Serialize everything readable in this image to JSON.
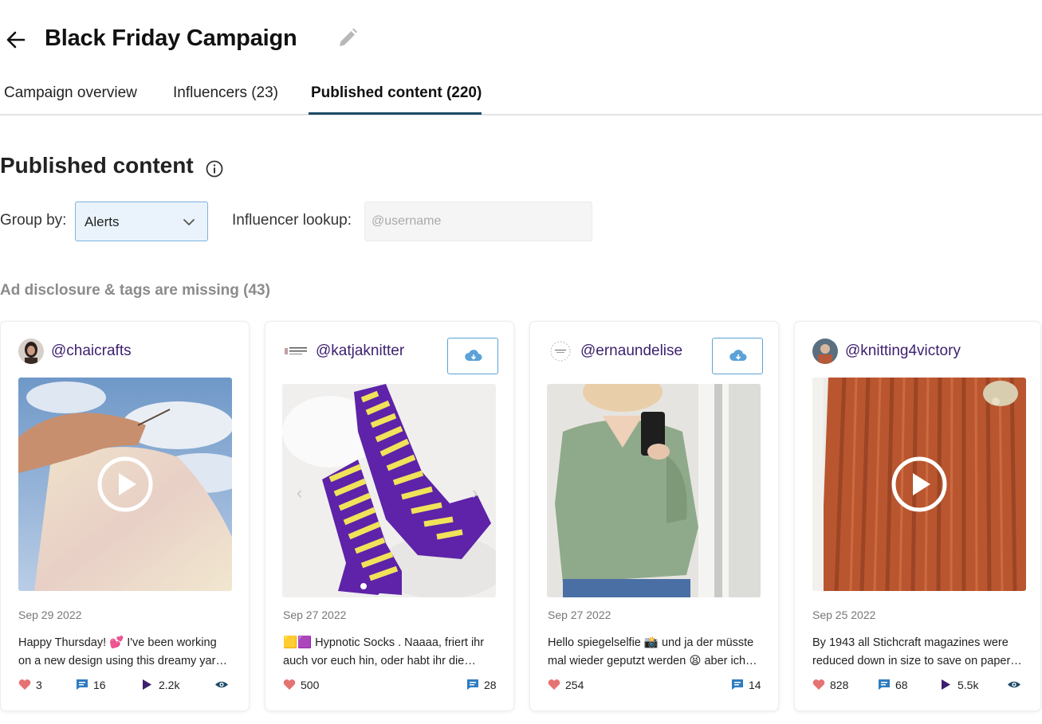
{
  "header": {
    "title": "Black Friday Campaign"
  },
  "tabs": [
    {
      "label": "Campaign overview"
    },
    {
      "label": "Influencers (23)"
    },
    {
      "label": "Published content (220)"
    }
  ],
  "section": {
    "title": "Published content"
  },
  "filters": {
    "group_by_label": "Group by:",
    "group_by_value": "Alerts",
    "lookup_label": "Influencer lookup:",
    "lookup_placeholder": "@username"
  },
  "group": {
    "heading": "Ad disclosure & tags are missing (43)"
  },
  "colors": {
    "accent": "#1d4a66",
    "username": "#3c1f6e",
    "download": "#5aa2d8",
    "like": "#e57373",
    "comment": "#2f7cc0",
    "play": "#3c1f6e"
  },
  "cards": [
    {
      "username": "@chaicrafts",
      "date": "Sep 29 2022",
      "caption_line1": "Happy Thursday! 💕 I've been working",
      "caption_line2": "on a new design using this dreamy yar…",
      "likes": "3",
      "comments": "16",
      "plays": "2.2k",
      "has_download": false,
      "is_video": true
    },
    {
      "username": "@katjaknitter",
      "date": "Sep 27 2022",
      "caption_line1": "🟨🟪 Hypnotic Socks . Naaaa, friert ihr",
      "caption_line2": "auch vor euch hin, oder habt ihr die…",
      "likes": "500",
      "comments": "28",
      "has_download": true,
      "is_video": false
    },
    {
      "username": "@ernaundelise",
      "date": "Sep 27 2022",
      "caption_line1": "Hello spiegelselfie 📸 und ja der müsste",
      "caption_line2": "mal wieder geputzt werden 😫 aber ich…",
      "likes": "254",
      "comments": "14",
      "has_download": true,
      "is_video": false
    },
    {
      "username": "@knitting4victory",
      "date": "Sep 25 2022",
      "caption_line1": "By 1943 all Stichcraft magazines were",
      "caption_line2": "reduced down in size to save on paper…",
      "likes": "828",
      "comments": "68",
      "plays": "5.5k",
      "has_download": false,
      "is_video": true
    }
  ]
}
